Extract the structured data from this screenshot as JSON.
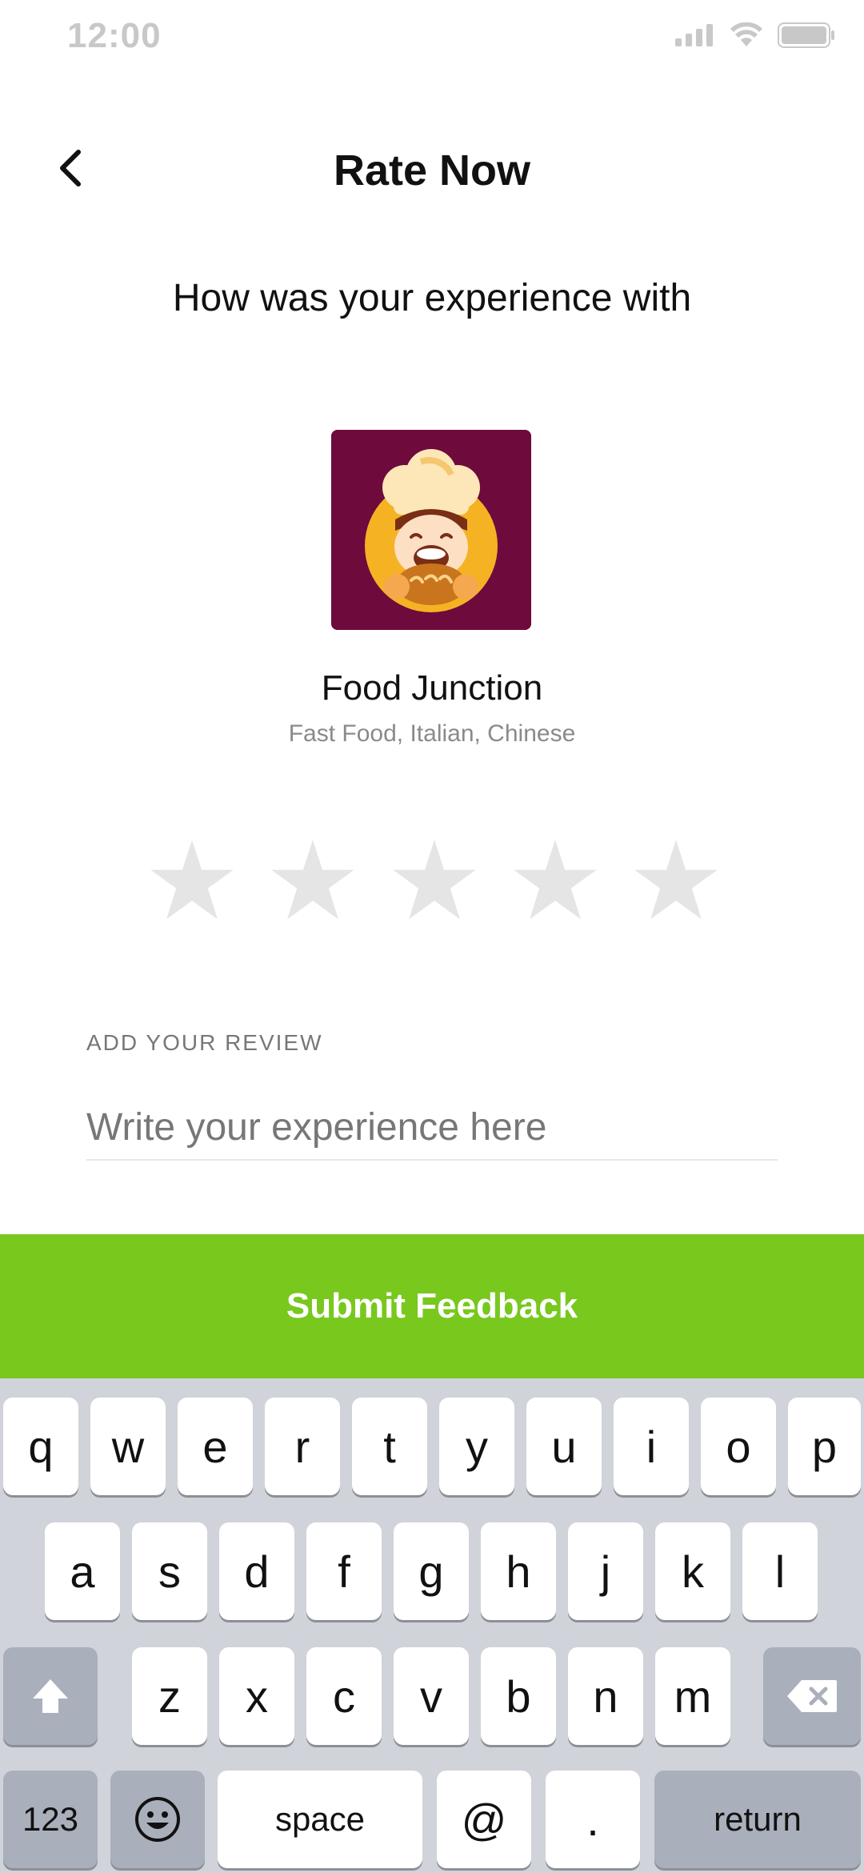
{
  "status_bar": {
    "time": "12:00",
    "icons": [
      "signal-icon",
      "wifi-icon",
      "battery-icon"
    ]
  },
  "header": {
    "back_icon": "chevron-left-icon",
    "title": "Rate Now"
  },
  "question": "How was your experience with",
  "restaurant": {
    "name": "Food Junction",
    "cuisine": "Fast Food, Italian, Chinese",
    "logo_bg": "#6e0a3c"
  },
  "rating": {
    "value": 0,
    "max": 5,
    "empty_color": "#e5e5e5"
  },
  "review": {
    "label": "ADD YOUR REVIEW",
    "placeholder": "Write your experience here",
    "value": ""
  },
  "submit": {
    "label": "Submit Feedback",
    "color": "#78c81e"
  },
  "keyboard": {
    "row1": [
      "q",
      "w",
      "e",
      "r",
      "t",
      "y",
      "u",
      "i",
      "o",
      "p"
    ],
    "row2": [
      "a",
      "s",
      "d",
      "f",
      "g",
      "h",
      "j",
      "k",
      "l"
    ],
    "row3": [
      "z",
      "x",
      "c",
      "v",
      "b",
      "n",
      "m"
    ],
    "numbers_label": "123",
    "space_label": "space",
    "at_label": "@",
    "dot_label": ".",
    "return_label": "return"
  }
}
